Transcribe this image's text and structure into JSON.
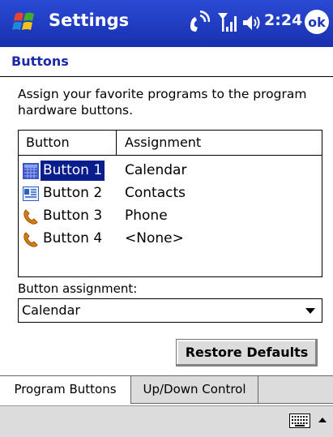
{
  "title_bar": {
    "app_title": "Settings",
    "clock": "2:24",
    "ok_label": "ok",
    "icons": [
      "windows-start-icon",
      "phone-signal-icon",
      "antenna-icon",
      "speaker-icon"
    ]
  },
  "page": {
    "heading": "Buttons",
    "instructions": "Assign your favorite programs to the program hardware buttons."
  },
  "list": {
    "columns": [
      "Button",
      "Assignment"
    ],
    "rows": [
      {
        "button": "Button 1",
        "assignment": "Calendar",
        "icon": "calendar-icon",
        "selected": true
      },
      {
        "button": "Button 2",
        "assignment": "Contacts",
        "icon": "contacts-card-icon",
        "selected": false
      },
      {
        "button": "Button 3",
        "assignment": "Phone",
        "icon": "phone-handset-icon",
        "selected": false
      },
      {
        "button": "Button 4",
        "assignment": "<None>",
        "icon": "phone-handset-icon",
        "selected": false
      }
    ]
  },
  "assignment": {
    "label": "Button assignment:",
    "selected_value": "Calendar"
  },
  "restore_button": "Restore Defaults",
  "tabs": [
    {
      "label": "Program Buttons",
      "active": true
    },
    {
      "label": "Up/Down Control",
      "active": false
    }
  ],
  "colors": {
    "title_bar": "#1c36b8",
    "selection": "#0a1d8c",
    "heading_text": "#1a2aa8"
  }
}
